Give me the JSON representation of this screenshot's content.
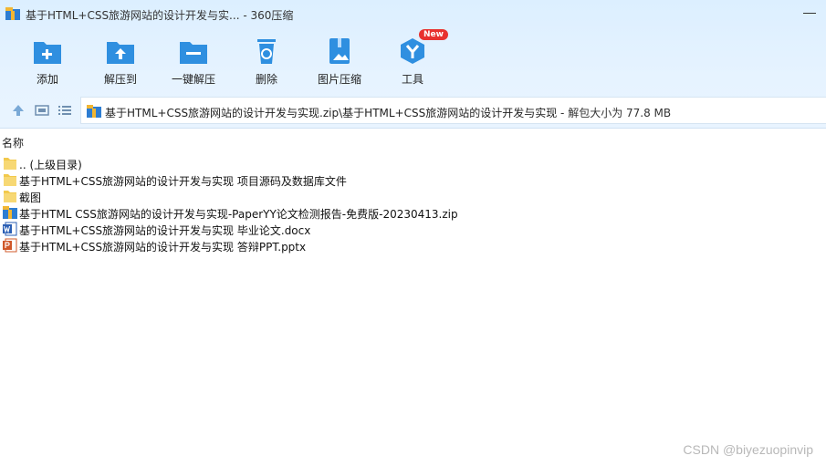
{
  "window": {
    "title": "基于HTML+CSS旅游网站的设计开发与实... - 360压缩"
  },
  "toolbar": {
    "items": [
      {
        "label": "添加",
        "icon": "add-folder-icon"
      },
      {
        "label": "解压到",
        "icon": "extract-to-icon"
      },
      {
        "label": "一键解压",
        "icon": "one-click-extract-icon"
      },
      {
        "label": "删除",
        "icon": "delete-icon"
      },
      {
        "label": "图片压缩",
        "icon": "image-compress-icon"
      },
      {
        "label": "工具",
        "icon": "tools-icon",
        "badge": "New"
      }
    ]
  },
  "address": {
    "path": "基于HTML+CSS旅游网站的设计开发与实现.zip\\基于HTML+CSS旅游网站的设计开发与实现",
    "info": " - 解包大小为 77.8 MB"
  },
  "list": {
    "column_name": "名称",
    "rows": [
      {
        "name": ".. (上级目录)",
        "icon": "folder-icon"
      },
      {
        "name": "基于HTML+CSS旅游网站的设计开发与实现 项目源码及数据库文件",
        "icon": "folder-icon"
      },
      {
        "name": "截图",
        "icon": "folder-icon"
      },
      {
        "name": "基于HTML CSS旅游网站的设计开发与实现-PaperYY论文检测报告-免费版-20230413.zip",
        "icon": "zip-icon"
      },
      {
        "name": "基于HTML+CSS旅游网站的设计开发与实现 毕业论文.docx",
        "icon": "word-icon"
      },
      {
        "name": "基于HTML+CSS旅游网站的设计开发与实现 答辩PPT.pptx",
        "icon": "powerpoint-icon"
      }
    ]
  },
  "watermark": "CSDN @biyezuopinvip",
  "colors": {
    "toolbar_icon": "#2f8fe0",
    "folder": "#f2c94c",
    "badge": "#e8312f"
  }
}
